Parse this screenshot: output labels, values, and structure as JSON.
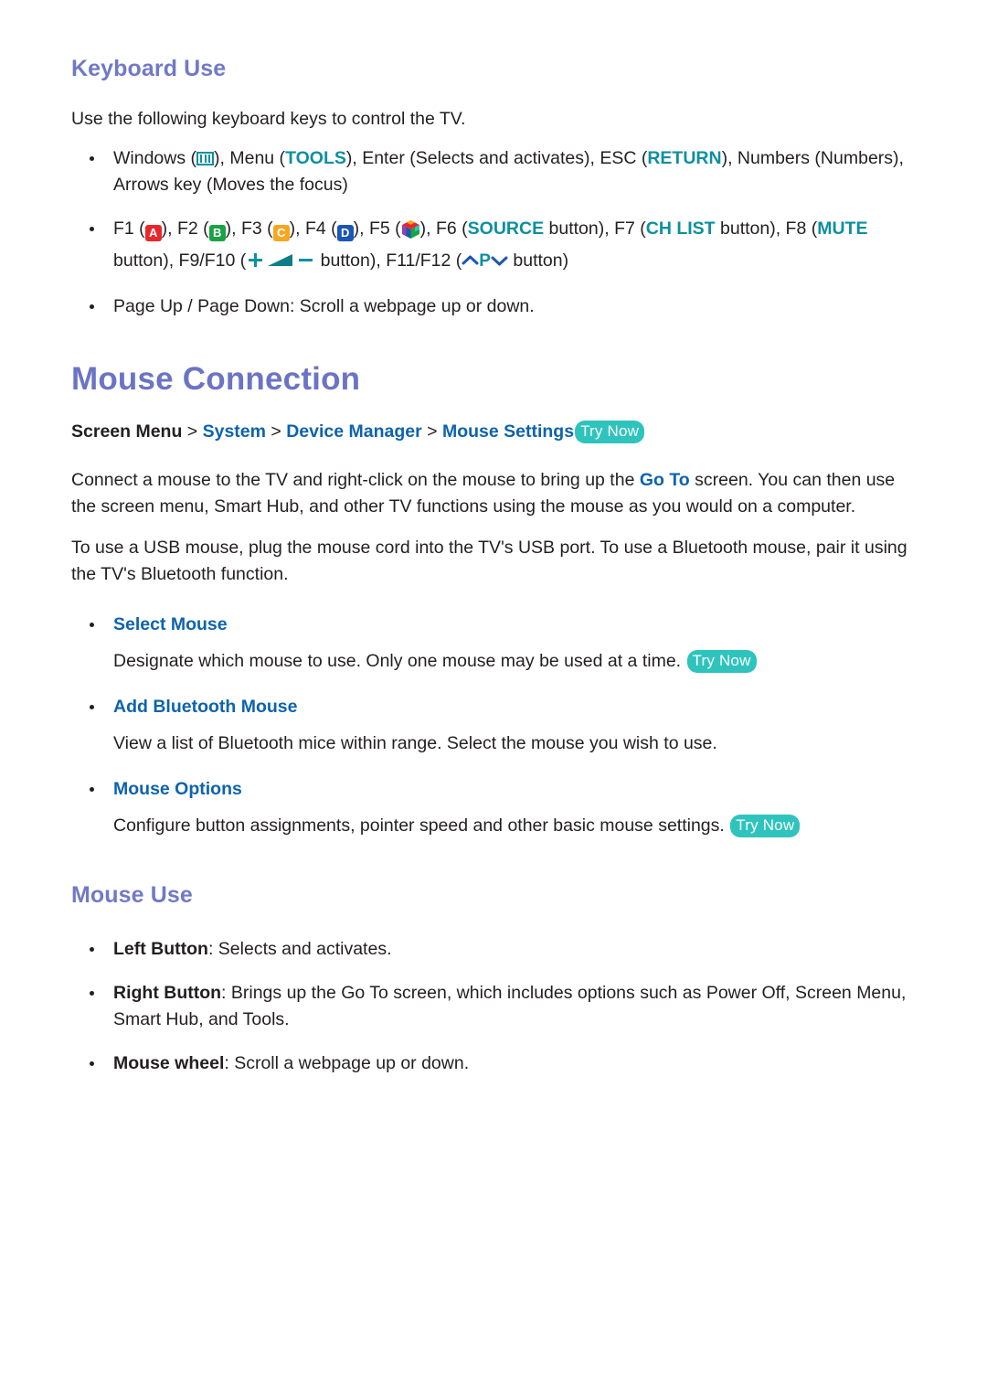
{
  "sections": {
    "keyboard": {
      "title": "Keyboard Use",
      "intro": "Use the following keyboard keys to control the TV.",
      "bullets": {
        "windows_line": {
          "windows_label": "Windows (",
          "windows_icon": "windows-menu-icon",
          "after_windows": "), Menu (",
          "tools": "TOOLS",
          "enter_part": "), Enter (Selects and activates), ESC (",
          "return": "RETURN",
          "numbers_part": "), Numbers (Numbers), Arrows key (Moves the focus)"
        },
        "fkeys_line": {
          "f1": "F1 (",
          "a_key": "A",
          "f2": "), F2 (",
          "b_key": "B",
          "f3": "), F3 (",
          "c_key": "C",
          "f4": "), F4 (",
          "d_key": "D",
          "f5": "), F5 (",
          "hub_icon": "smart-hub-icon",
          "f6": "), F6 (",
          "source": "SOURCE",
          "f7": " button), F7 (",
          "chlist": "CH LIST",
          "f8": " button), F8 (",
          "mute": "MUTE",
          "f9f10": " button), F9/F10 (",
          "vol_plus_icon": "volume-plus-icon",
          "vol_wedge_icon": "volume-wedge-icon",
          "vol_minus_icon": "volume-minus-icon",
          "f11f12": " button), F11/F12 (",
          "ch_up_icon": "channel-up-icon",
          "p_label": "P",
          "ch_down_icon": "channel-down-icon",
          "tail": " button)"
        },
        "page_line": "Page Up / Page Down: Scroll a webpage up or down."
      }
    },
    "mouse_connection": {
      "title": "Mouse Connection",
      "breadcrumb": {
        "root": "Screen Menu",
        "sep": " > ",
        "item1": "System",
        "item2": "Device Manager",
        "item3": "Mouse Settings",
        "try_now": "Try Now"
      },
      "para1_a": "Connect a mouse to the TV and right-click on the mouse to bring up the ",
      "para1_link": "Go To",
      "para1_b": " screen. You can then use the screen menu, Smart Hub, and other TV functions using the mouse as you would on a computer.",
      "para2": "To use a USB mouse, plug the mouse cord into the TV's USB port. To use a Bluetooth mouse, pair it using the TV's Bluetooth function.",
      "options": [
        {
          "name": "Select Mouse",
          "desc": "Designate which mouse to use. Only one mouse may be used at a time.",
          "try_now": "Try Now"
        },
        {
          "name": "Add Bluetooth Mouse",
          "desc": "View a list of Bluetooth mice within range. Select the mouse you wish to use.",
          "try_now": ""
        },
        {
          "name": "Mouse Options",
          "desc": "Configure button assignments, pointer speed and other basic mouse settings.",
          "try_now": "Try Now"
        }
      ]
    },
    "mouse_use": {
      "title": "Mouse Use",
      "items": [
        {
          "label": "Left Button",
          "text": ": Selects and activates."
        },
        {
          "label": "Right Button",
          "text": ": Brings up the Go To screen, which includes options such as Power Off, Screen Menu, Smart Hub, and Tools."
        },
        {
          "label": "Mouse wheel",
          "text": ": Scroll a webpage up or down."
        }
      ]
    }
  },
  "colors": {
    "heading": "#7179c6",
    "teal": "#0d8fa0",
    "blue": "#0d63ad",
    "try_now_bg": "#2ec4bd",
    "key_a": "#e8272c",
    "key_b": "#19a345",
    "key_c": "#f6a721",
    "key_d": "#1b57b3",
    "text": "#231f20"
  }
}
